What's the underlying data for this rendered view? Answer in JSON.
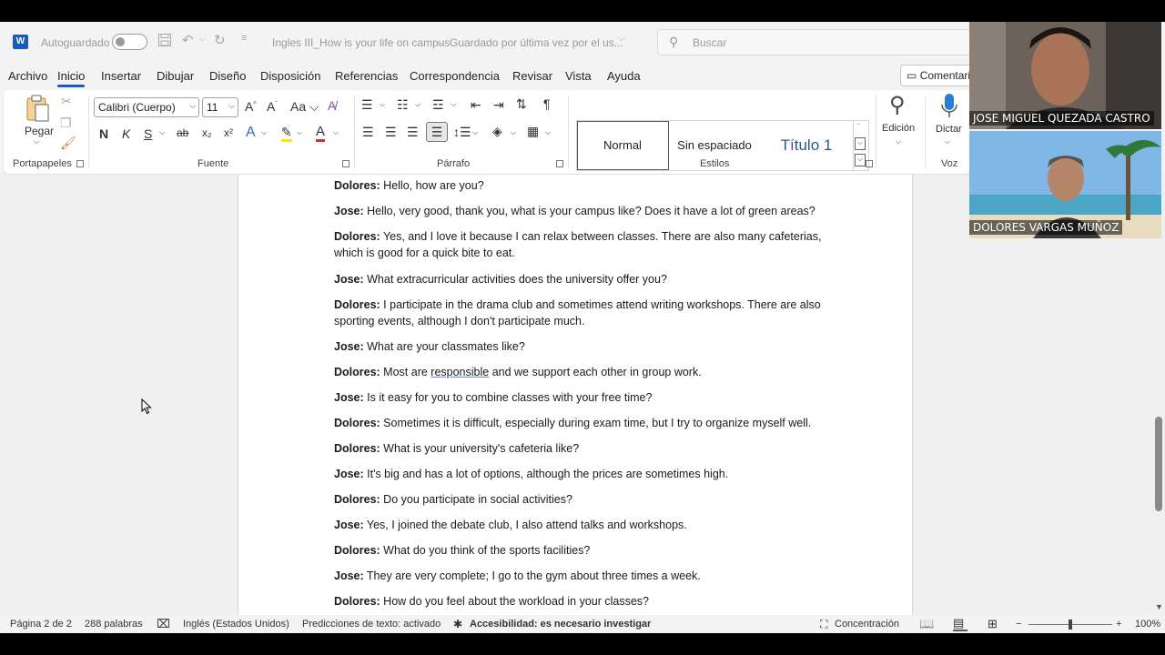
{
  "titlebar": {
    "autosave_label": "Autoguardado",
    "doc_title": "Ingles III_How is your life on campus",
    "save_status": "Guardado por última vez por el us...",
    "search_placeholder": "Buscar"
  },
  "menu": {
    "items": [
      "Archivo",
      "Inicio",
      "Insertar",
      "Dibujar",
      "Diseño",
      "Disposición",
      "Referencias",
      "Correspondencia",
      "Revisar",
      "Vista",
      "Ayuda"
    ],
    "active": "Inicio",
    "comments_button": "Comentarios"
  },
  "ribbon": {
    "paste_label": "Pegar",
    "clipboard_group": "Portapapeles",
    "font_name": "Calibri (Cuerpo)",
    "font_size": "11",
    "font_group": "Fuente",
    "paragraph_group": "Párrafo",
    "styles_group": "Estilos",
    "styles": [
      "Normal",
      "Sin espaciado",
      "Título 1"
    ],
    "editing_label": "Edición",
    "dictate_label": "Dictar",
    "voice_group": "Voz",
    "bold_glyph": "N",
    "italic_glyph": "K",
    "underline_glyph": "S"
  },
  "document": {
    "lines": [
      {
        "speaker": "Dolores:",
        "text": " Hello, how are you?"
      },
      {
        "speaker": "Jose:",
        "text": " Hello, very good, thank you, what is your campus like? Does it have a lot of green areas?"
      },
      {
        "speaker": "Dolores:",
        "text": " Yes, and I love it because I can relax between classes. There are also many cafeterias,",
        "text2": "which is good for a quick bite to eat."
      },
      {
        "speaker": "Jose:",
        "text": " What extracurricular activities does the university offer you?"
      },
      {
        "speaker": "Dolores:",
        "text": " I participate in the drama club and sometimes attend writing workshops. There are also",
        "text2": "sporting events, although I don't participate much."
      },
      {
        "speaker": "Jose:",
        "text": " What are your classmates like?"
      },
      {
        "speaker": "Dolores:",
        "text_a": " Most are ",
        "underlined": "responsible",
        "text_b": " and we support each other in group work."
      },
      {
        "speaker": "Jose:",
        "text": " Is it easy for you to combine classes with your free time?"
      },
      {
        "speaker": "Dolores:",
        "text": " Sometimes it is difficult, especially during exam time, but I try to organize myself well."
      },
      {
        "speaker": "Dolores:",
        "text": " What is your university's cafeteria like?"
      },
      {
        "speaker": "Jose:",
        "text": " It's big and has a lot of options, although the prices are sometimes high."
      },
      {
        "speaker": "Dolores:",
        "text": " Do you participate in social activities?"
      },
      {
        "speaker": "Jose:",
        "text": " Yes, I joined the debate club, I also attend talks and workshops."
      },
      {
        "speaker": "Dolores:",
        "text": " What do you think of the sports facilities?"
      },
      {
        "speaker": "Jose:",
        "text": " They are very complete; I go to the gym about three times a week."
      },
      {
        "speaker": "Dolores:",
        "text": " How do you feel about the workload in your classes?"
      }
    ]
  },
  "statusbar": {
    "page": "Página 2 de 2",
    "words": "288 palabras",
    "language": "Inglés (Estados Unidos)",
    "predictions": "Predicciones de texto: activado",
    "accessibility": "Accesibilidad: es necesario investigar",
    "focus": "Concentración",
    "zoom": "100%"
  },
  "participants": [
    {
      "name": "JOSE MIGUEL QUEZADA CASTRO"
    },
    {
      "name": "DOLORES VARGAS MUÑOZ"
    }
  ],
  "colors": {
    "accent": "#185abd"
  }
}
